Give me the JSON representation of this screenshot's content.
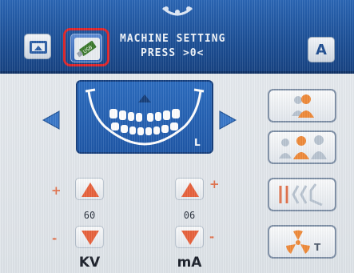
{
  "header": {
    "line1": "MACHINE SETTING",
    "line2": "PRESS >0<",
    "mode_button_label": "A",
    "usb_label": "USB"
  },
  "colors": {
    "header_blue": "#1f58a8",
    "highlight_red": "#e0262b",
    "accent_orange": "#e2744e",
    "stepper_orange": "#e8623d"
  },
  "icons": {
    "display": "display-icon",
    "usb": "usb-icon",
    "jaw": "dental-jaw-icon",
    "patient_small": "patient-single-icon",
    "patient_group": "patient-group-icon",
    "path": "exposure-path-icon",
    "radiation": "radiation-timer-icon"
  },
  "jaw_panel": {
    "side_label": "L"
  },
  "radiation_button": {
    "label": "T"
  },
  "kv": {
    "plus": "+",
    "minus": "-",
    "value": "60",
    "unit": "KV"
  },
  "ma": {
    "plus": "+",
    "minus": "-",
    "value": "06",
    "unit": "mA"
  }
}
